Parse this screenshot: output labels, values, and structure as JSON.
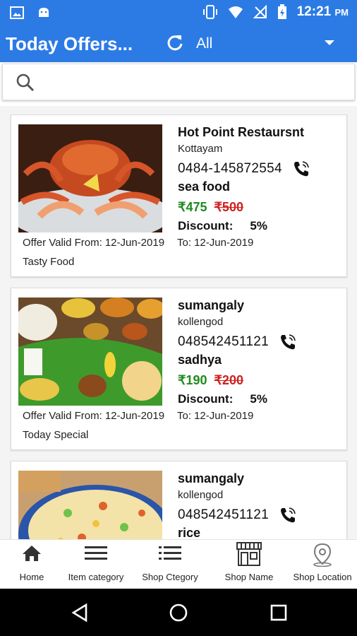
{
  "status_bar": {
    "time": "12:21",
    "ampm": "PM"
  },
  "app_bar": {
    "title": "Today Offers...",
    "filter_value": "All"
  },
  "search": {
    "placeholder": ""
  },
  "offers": [
    {
      "shop": "Hot Point Restaursnt",
      "city": "Kottayam",
      "phone": "0484-145872554",
      "item": "sea food",
      "offer_price": "₹475",
      "original_price": "₹500",
      "discount_label": "Discount:",
      "discount_value": "5%",
      "valid_from_label": "Offer Valid From:",
      "valid_from": "12-Jun-2019",
      "to_label": "To:",
      "valid_to": "12-Jun-2019",
      "tag": "Tasty Food"
    },
    {
      "shop": "sumangaly",
      "city": "kollengod",
      "phone": "048542451121",
      "item": "sadhya",
      "offer_price": "₹190",
      "original_price": "₹200",
      "discount_label": "Discount:",
      "discount_value": "5%",
      "valid_from_label": "Offer Valid From:",
      "valid_from": "12-Jun-2019",
      "to_label": "To:",
      "valid_to": "12-Jun-2019",
      "tag": "Today Special"
    },
    {
      "shop": "sumangaly",
      "city": "kollengod",
      "phone": "048542451121",
      "item": "rice"
    }
  ],
  "bottom_nav": [
    {
      "label": "Home",
      "icon": "home-icon"
    },
    {
      "label": "Item category",
      "icon": "menu-lines-icon"
    },
    {
      "label": "Shop Ctegory",
      "icon": "list-icon"
    },
    {
      "label": "Shop Name",
      "icon": "storefront-icon"
    },
    {
      "label": "Shop Location",
      "icon": "location-pin-icon"
    }
  ],
  "colors": {
    "primary": "#2c7be5",
    "offer_price": "#1f8a1f",
    "original_price": "#d11e1e"
  }
}
